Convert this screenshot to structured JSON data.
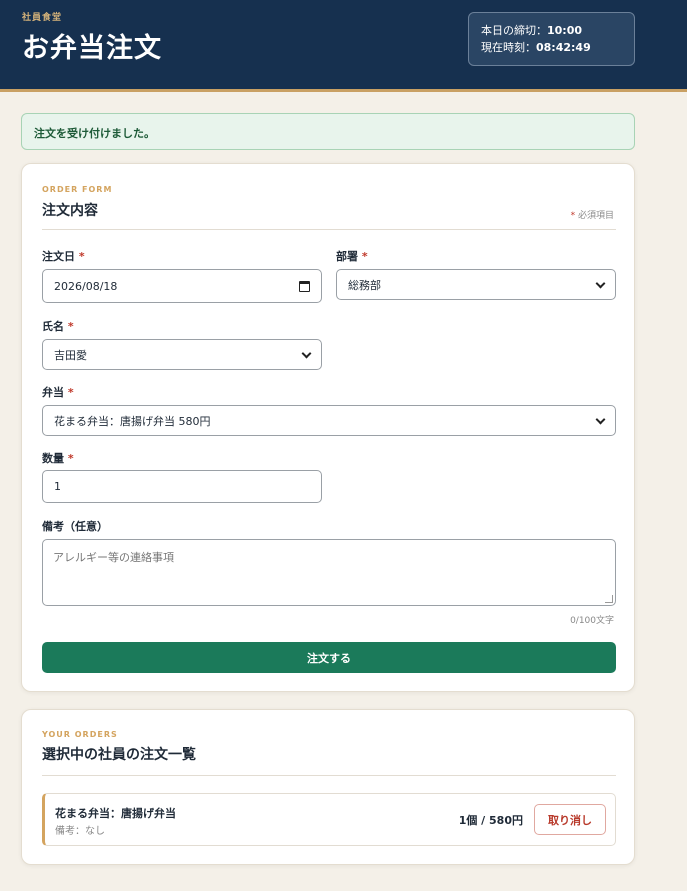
{
  "header": {
    "kicker": "社員食堂",
    "title": "お弁当注文",
    "deadline_label": "本日の締切：",
    "deadline_value": "10:00",
    "now_label": "現在時刻：",
    "now_value": "08:42:49"
  },
  "alert": {
    "message": "注文を受け付けました。"
  },
  "form": {
    "kicker": "ORDER FORM",
    "title": "注文内容",
    "required_mark": "*",
    "required_note": "必須項目",
    "date": {
      "label": "注文日",
      "value": "2026/08/18"
    },
    "department": {
      "label": "部署",
      "value": "総務部"
    },
    "name": {
      "label": "氏名",
      "value": "吉田愛"
    },
    "bento": {
      "label": "弁当",
      "value": "花まる弁当：唐揚げ弁当 580円"
    },
    "quantity": {
      "label": "数量",
      "value": "1"
    },
    "remarks": {
      "label": "備考（任意）",
      "placeholder": "アレルギー等の連絡事項",
      "counter": "0/100文字"
    },
    "submit_label": "注文する"
  },
  "orders": {
    "kicker": "YOUR ORDERS",
    "title": "選択中の社員の注文一覧",
    "items": [
      {
        "name": "花まる弁当：唐揚げ弁当",
        "note": "備考：なし",
        "qty_price": "1個 / 580円",
        "cancel_label": "取り消し"
      }
    ]
  },
  "colors": {
    "header_bg": "#16304f",
    "accent_gold": "#c9a063",
    "primary_green": "#1b7a5a",
    "danger": "#b8392a"
  }
}
